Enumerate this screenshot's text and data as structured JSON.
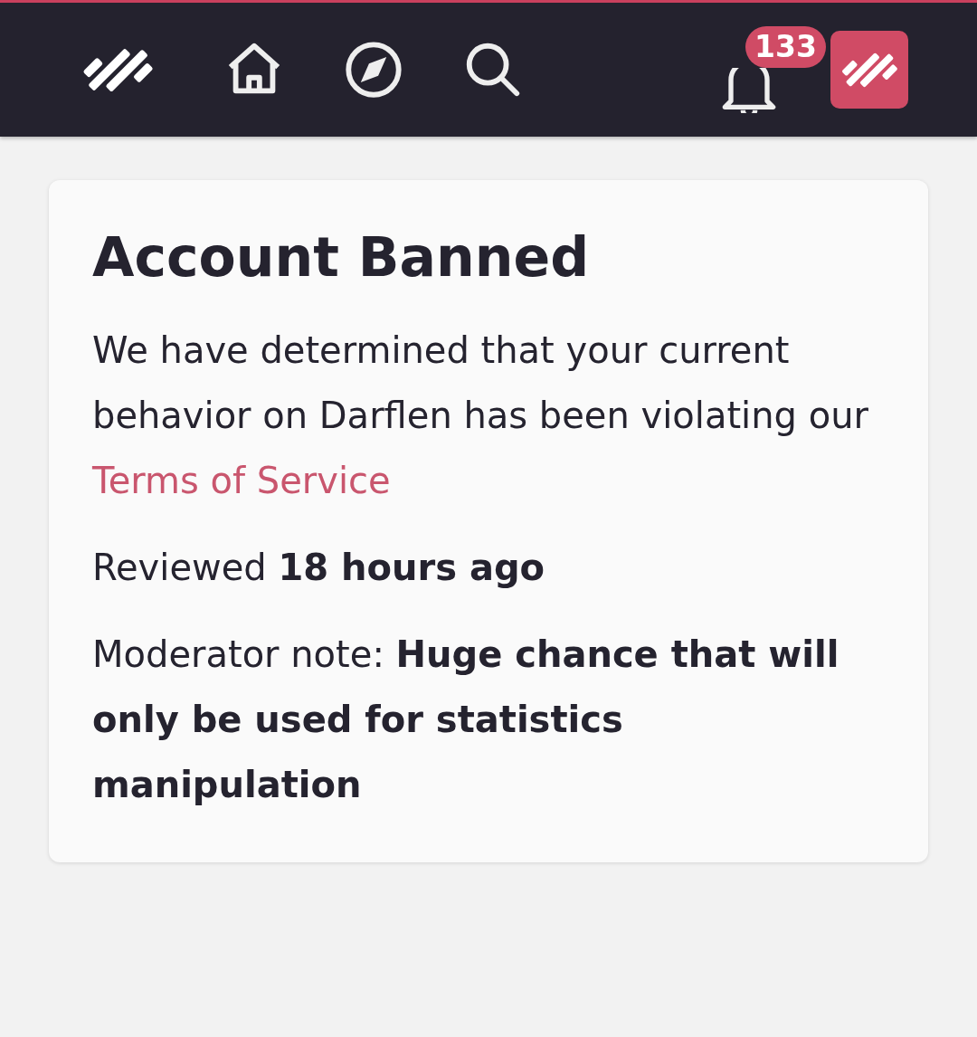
{
  "header": {
    "notification_count": "133"
  },
  "card": {
    "title": "Account Banned",
    "message": {
      "text": "We have determined that your current behavior on Darflen has been violating our",
      "link": "Terms of Service"
    },
    "reviewed": "Reviewed **18 hours ago**",
    "moderator_note": "Moderator note: **Huge chance that will only be used for statistics manipulation**"
  }
}
